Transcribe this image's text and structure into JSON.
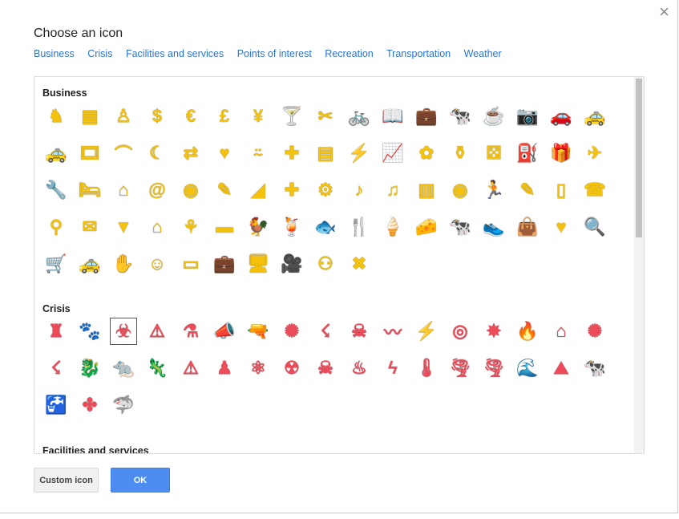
{
  "dialog": {
    "title": "Choose an icon",
    "close_icon": "×",
    "tabs": [
      "Business",
      "Crisis",
      "Facilities and services",
      "Points of interest",
      "Recreation",
      "Transportation",
      "Weather"
    ],
    "sections": [
      {
        "title": "Business"
      },
      {
        "title": "Crisis"
      },
      {
        "title": "Facilities and services"
      }
    ],
    "buttons": {
      "custom": "Custom icon",
      "ok": "OK"
    },
    "colors": {
      "business": "#f4c20d",
      "crisis": "#ee4b5a",
      "link": "#2a74d3",
      "primary_button": "#4d8df1"
    }
  }
}
